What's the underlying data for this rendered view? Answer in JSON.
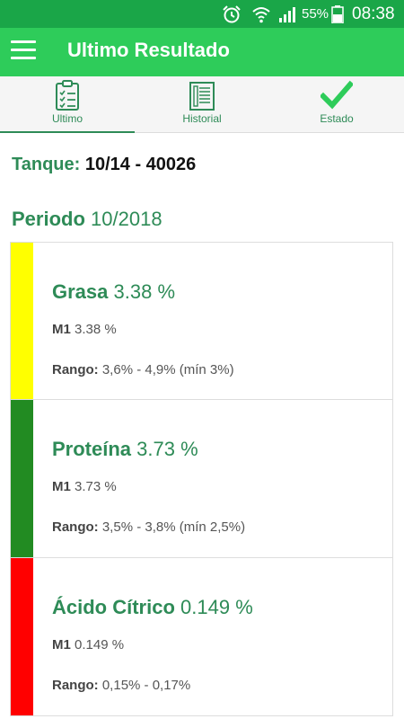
{
  "status_bar": {
    "battery": "55%",
    "time": "08:38",
    "icons": [
      "alarm-icon",
      "wifi-icon",
      "signal-icon",
      "battery-icon"
    ]
  },
  "app_bar": {
    "title": "Ultimo Resultado",
    "menu_icon": "hamburger-menu-icon"
  },
  "tabs": [
    {
      "label": "Ultimo",
      "icon": "clipboard-icon",
      "selected": true
    },
    {
      "label": "Historial",
      "icon": "document-list-icon",
      "selected": false
    },
    {
      "label": "Estado",
      "icon": "checkmark-icon",
      "selected": false
    }
  ],
  "tanque": {
    "label": "Tanque:",
    "value": "10/14 - 40026"
  },
  "periodo": {
    "label": "Periodo",
    "value": "10/2018"
  },
  "results": [
    {
      "name": "Grasa",
      "value": "3.38 %",
      "m1_label": "M1",
      "m1_value": "3.38 %",
      "rango_label": "Rango:",
      "rango_value": "3,6% - 4,9% (mín 3%)",
      "color": "#ffff00"
    },
    {
      "name": "Proteína",
      "value": "3.73 %",
      "m1_label": "M1",
      "m1_value": "3.73 %",
      "rango_label": "Rango:",
      "rango_value": "3,5% - 3,8% (mín 2,5%)",
      "color": "#228b22"
    },
    {
      "name": "Ácido Cítrico",
      "value": "0.149 %",
      "m1_label": "M1",
      "m1_value": "0.149 %",
      "rango_label": "Rango:",
      "rango_value": "0,15% - 0,17%",
      "color": "#ff0000"
    }
  ],
  "colors": {
    "status_bar": "#1aa648",
    "app_bar": "#2ecc5a",
    "accent": "#2e8b57"
  }
}
